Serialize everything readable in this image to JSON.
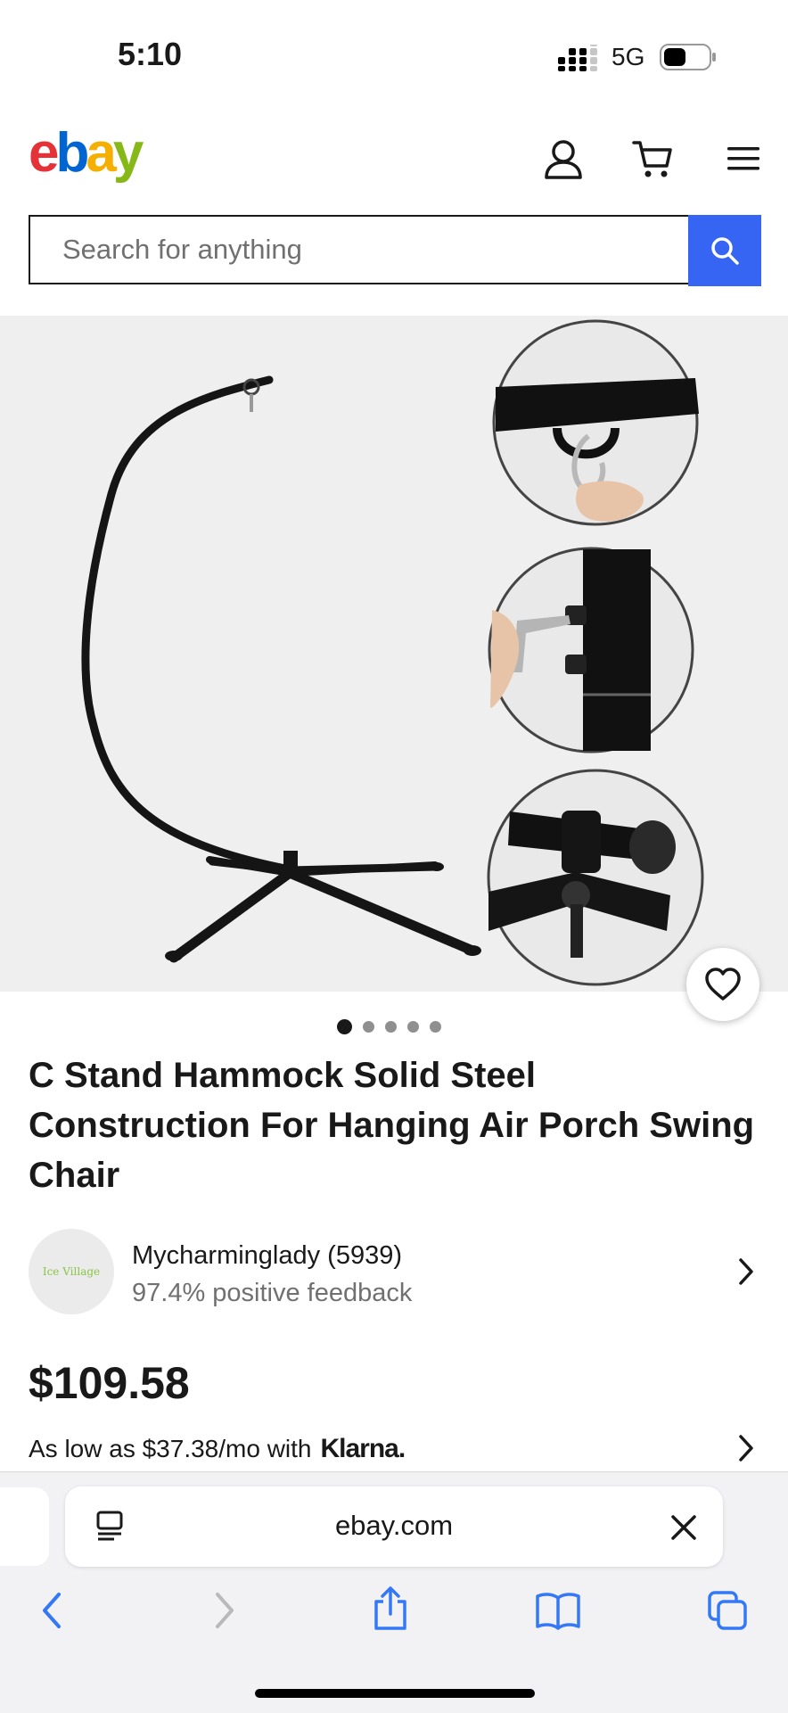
{
  "status_bar": {
    "time": "5:10",
    "network": "5G"
  },
  "header": {
    "logo": {
      "e": "e",
      "b": "b",
      "a": "a",
      "y": "y"
    }
  },
  "search": {
    "placeholder": "Search for anything"
  },
  "gallery": {
    "image_count": 5,
    "active_index": 0
  },
  "product": {
    "title": "C Stand Hammock Solid Steel Construction For Hanging Air Porch Swing Chair",
    "price": "$109.58",
    "financing_text": "As low as $37.38/mo with",
    "financing_brand": "Klarna."
  },
  "seller": {
    "name": "Mycharminglady (5939)",
    "feedback": "97.4% positive feedback",
    "avatar_text": "Ice Village"
  },
  "browser": {
    "url": "ebay.com"
  },
  "colors": {
    "accent": "#3665f3",
    "ebay_red": "#e53238",
    "ebay_blue": "#0064d2",
    "ebay_yellow": "#f5af02",
    "ebay_green": "#86b817"
  }
}
